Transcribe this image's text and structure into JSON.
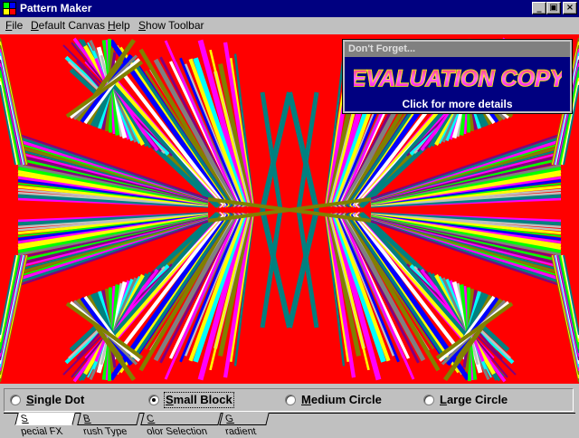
{
  "window": {
    "title": "Pattern Maker",
    "controls": {
      "minimize": "_",
      "maximize": "▣",
      "close": "×"
    }
  },
  "menu": {
    "items": [
      {
        "label": "File",
        "accel": "F",
        "rest": "ile"
      },
      {
        "label": "Default Canvas",
        "accel": "D",
        "rest": "efault Canvas"
      },
      {
        "label": "Help",
        "accel": "H",
        "rest": "elp"
      },
      {
        "label": "Show Toolbar",
        "accel": "S",
        "rest": "how Toolbar"
      }
    ]
  },
  "canvas": {
    "background": "#ff0000",
    "palette": [
      "#ff00ff",
      "#00ffff",
      "#ffff00",
      "#00ff00",
      "#808000",
      "#008080",
      "#808080",
      "#c0c0c0",
      "#ffffff",
      "#800080",
      "#0000ff"
    ]
  },
  "banner": {
    "header": "Don't Forget...",
    "title": "EVALUATION COPY",
    "details": "Click for more details"
  },
  "toolbar": {
    "options": [
      {
        "label": "Single Dot",
        "accel": "S",
        "rest": "ingle Dot",
        "selected": false
      },
      {
        "label": "Small Block",
        "accel": "S",
        "rest": "mall Block",
        "selected": true
      },
      {
        "label": "Medium Circle",
        "accel": "M",
        "rest": "edium Circle",
        "selected": false
      },
      {
        "label": "Large Circle",
        "accel": "L",
        "rest": "arge Circle",
        "selected": false
      }
    ],
    "tabs": [
      {
        "label": "Special FX",
        "accel": "S",
        "rest": "pecial FX",
        "active": true
      },
      {
        "label": "Brush Type",
        "accel": "B",
        "rest": "rush Type",
        "active": false
      },
      {
        "label": "Color Selection",
        "accel": "C",
        "rest": "olor Selection",
        "active": false
      },
      {
        "label": "Gradient",
        "accel": "G",
        "rest": "radient",
        "active": false
      }
    ]
  }
}
